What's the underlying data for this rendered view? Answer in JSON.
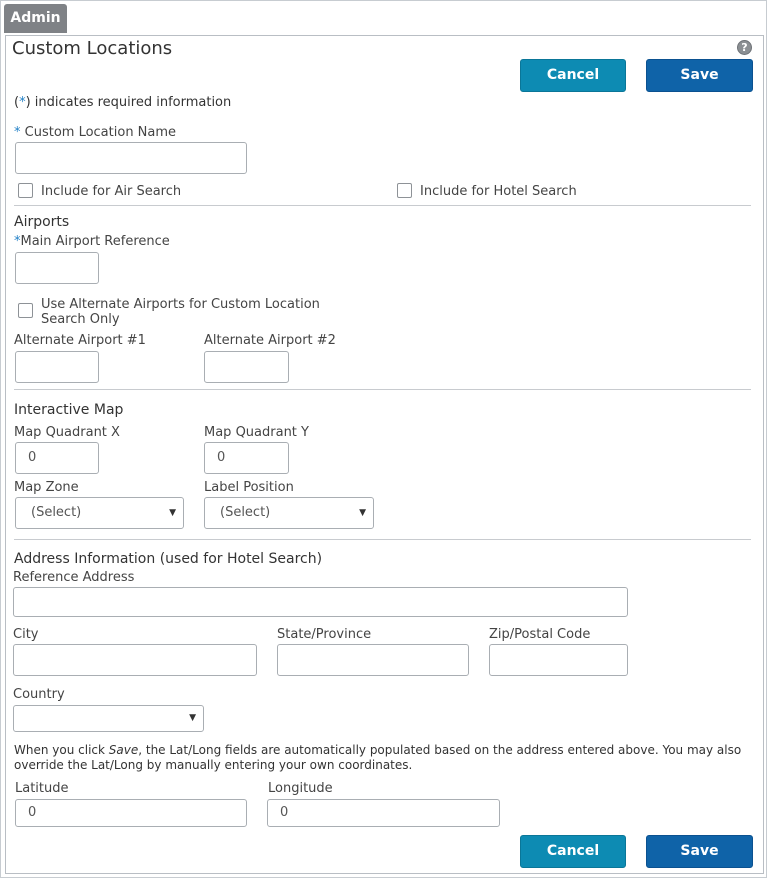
{
  "tab": {
    "label": "Admin"
  },
  "page": {
    "title": "Custom Locations",
    "help_icon": "question-mark"
  },
  "toolbar": {
    "cancel_label": "Cancel",
    "save_label": "Save"
  },
  "required_note": {
    "star": "*",
    "text": " indicates required information"
  },
  "custom_location": {
    "label_star": "*",
    "label": " Custom Location Name",
    "value": "",
    "include_air_label": "Include for Air Search",
    "include_hotel_label": "Include for Hotel Search"
  },
  "airports": {
    "heading": "Airports",
    "main_star": "*",
    "main_label": "Main Airport Reference",
    "main_value": "",
    "use_alternate_label": "Use Alternate Airports for Custom Location Search Only",
    "alt1_label": "Alternate Airport #1",
    "alt1_value": "",
    "alt2_label": "Alternate Airport #2",
    "alt2_value": ""
  },
  "map": {
    "heading": "Interactive Map",
    "quadrant_x_label": "Map Quadrant X",
    "quadrant_x_value": "0",
    "quadrant_y_label": "Map Quadrant Y",
    "quadrant_y_value": "0",
    "zone_label": "Map Zone",
    "zone_value": "(Select)",
    "label_position_label": "Label Position",
    "label_position_value": "(Select)"
  },
  "address": {
    "heading": "Address Information (used for Hotel Search)",
    "reference_label": "Reference Address",
    "reference_value": "",
    "city_label": "City",
    "city_value": "",
    "state_label": "State/Province",
    "state_value": "",
    "zip_label": "Zip/Postal Code",
    "zip_value": "",
    "country_label": "Country",
    "country_value": "",
    "info_pre": "When you click ",
    "info_em": "Save",
    "info_post": ", the Lat/Long fields are automatically populated based on the address entered above. You may also override the Lat/Long by manually entering your own coordinates.",
    "latitude_label": "Latitude",
    "latitude_value": "0",
    "longitude_label": "Longitude",
    "longitude_value": "0"
  },
  "colors": {
    "cancel_button": "#0d8bb3",
    "save_button": "#0f63a8",
    "admin_tab": "#7f8286",
    "required_star": "#1f7fc6"
  }
}
